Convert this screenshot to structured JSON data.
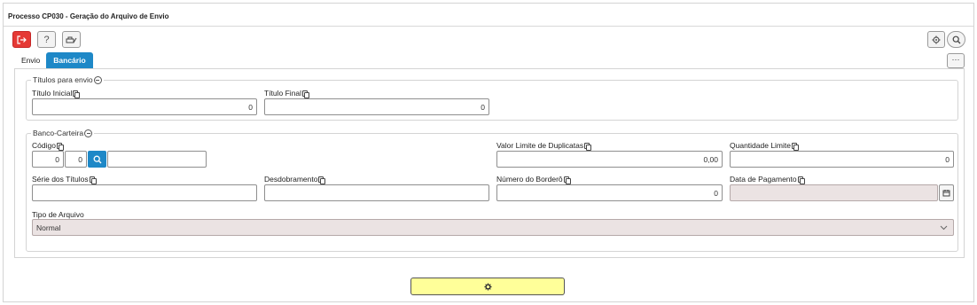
{
  "window": {
    "title": "Processo CP030 - Geração do Arquivo de Envio"
  },
  "toolbar": {
    "exit_icon": "exit-icon",
    "help_label": "?",
    "print_icon": "print-icon",
    "settings_icon": "gear-icon",
    "search_icon": "search-icon"
  },
  "tabs": [
    {
      "label": "Envio",
      "active": false
    },
    {
      "label": "Bancário",
      "active": true
    }
  ],
  "more_label": "···",
  "section_titulos": {
    "legend": "Títulos para envio",
    "titulo_inicial": {
      "label": "Título Inicial",
      "value": "0"
    },
    "titulo_final": {
      "label": "Título Final",
      "value": "0"
    }
  },
  "section_banco": {
    "legend": "Banco-Carteira",
    "codigo": {
      "label": "Código",
      "banco": "0",
      "carteira": "0",
      "descricao": ""
    },
    "valor_limite": {
      "label": "Valor Limite de Duplicatas",
      "value": "0,00"
    },
    "quantidade_limite": {
      "label": "Quantidade Limite",
      "value": "0"
    },
    "serie_titulos": {
      "label": "Série dos Títulos",
      "value": ""
    },
    "desdobramento": {
      "label": "Desdobramento",
      "value": ""
    },
    "numero_bordero": {
      "label": "Número do Borderô",
      "value": "0"
    },
    "data_pagamento": {
      "label": "Data de Pagamento",
      "value": ""
    },
    "tipo_arquivo": {
      "label": "Tipo de Arquivo",
      "value": "Normal"
    }
  },
  "execute_icon": "gear-icon",
  "colors": {
    "accent": "#1e88c7",
    "exit": "#e53935",
    "execute_bg": "#ffff99"
  }
}
